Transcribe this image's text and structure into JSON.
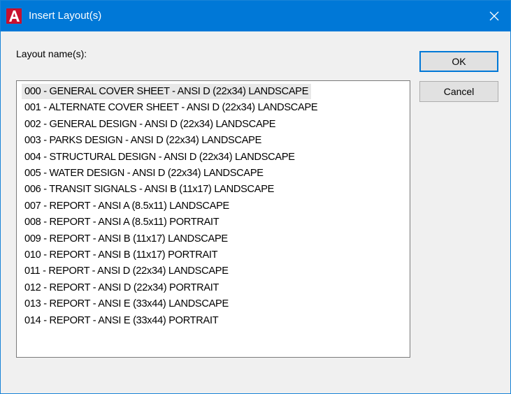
{
  "window": {
    "title": "Insert Layout(s)",
    "icon": "autocad-a-icon",
    "accent": "#0078d7",
    "icon_color": "#d0021b"
  },
  "form": {
    "label": "Layout name(s):",
    "selected_index": 0,
    "layouts": [
      "000 - GENERAL COVER SHEET - ANSI D (22x34) LANDSCAPE",
      "001 - ALTERNATE COVER SHEET - ANSI D (22x34) LANDSCAPE",
      "002 - GENERAL DESIGN - ANSI D (22x34) LANDSCAPE",
      "003 - PARKS DESIGN - ANSI D (22x34) LANDSCAPE",
      "004 - STRUCTURAL DESIGN - ANSI D (22x34) LANDSCAPE",
      "005 - WATER DESIGN - ANSI D (22x34) LANDSCAPE",
      "006 - TRANSIT SIGNALS - ANSI B (11x17) LANDSCAPE",
      "007 - REPORT - ANSI A (8.5x11) LANDSCAPE",
      "008 - REPORT - ANSI A (8.5x11) PORTRAIT",
      "009 - REPORT - ANSI B (11x17) LANDSCAPE",
      "010 - REPORT - ANSI B (11x17) PORTRAIT",
      "011 - REPORT - ANSI D (22x34) LANDSCAPE",
      "012 - REPORT - ANSI D (22x34) PORTRAIT",
      "013 - REPORT - ANSI E (33x44) LANDSCAPE",
      "014 - REPORT - ANSI E (33x44) PORTRAIT"
    ]
  },
  "buttons": {
    "ok": "OK",
    "cancel": "Cancel"
  }
}
